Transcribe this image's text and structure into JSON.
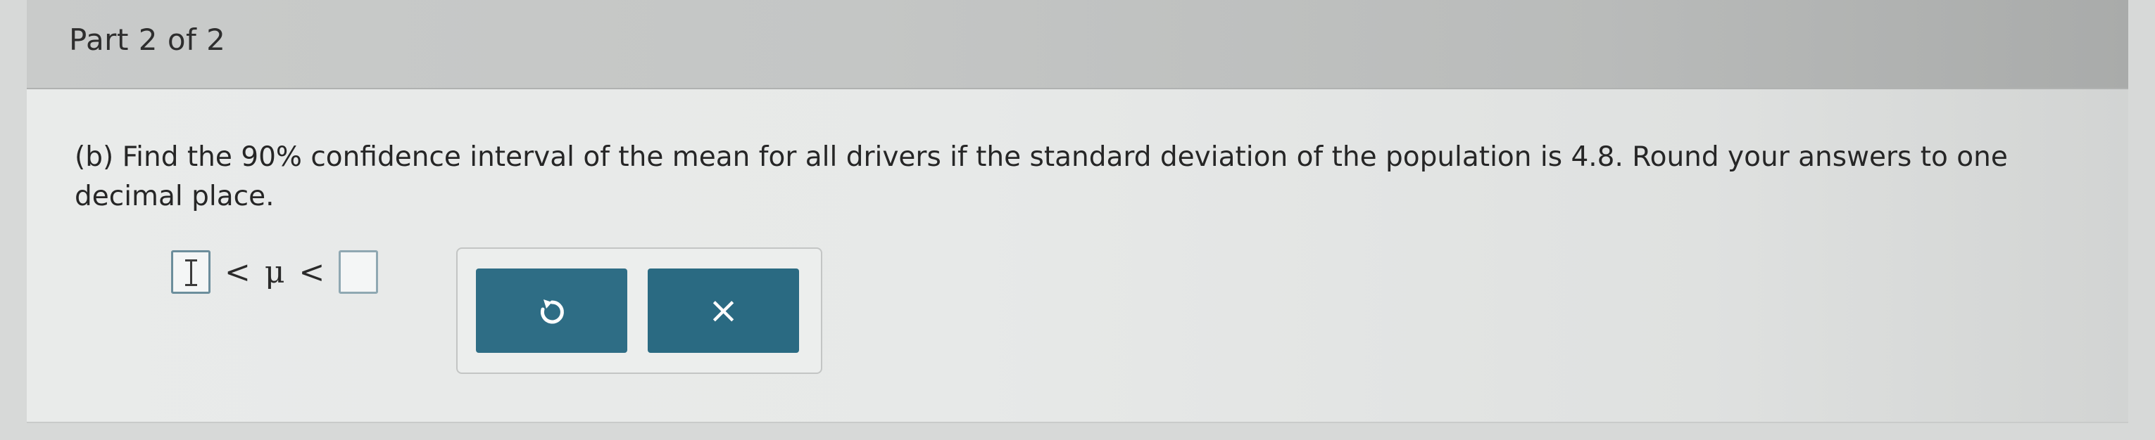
{
  "header": {
    "title": "Part 2 of 2"
  },
  "question": {
    "text": "(b) Find the 90% confidence interval of the mean for all drivers if the standard deviation of the population is 4.8. Round your answers to one decimal place."
  },
  "answer": {
    "lower_value": "",
    "upper_value": "",
    "less_than_left": "<",
    "mu_symbol": "μ",
    "less_than_right": "<"
  },
  "buttons": {
    "undo_icon": "undo-icon",
    "clear_label": "×",
    "clear_icon": "close-icon"
  },
  "colors": {
    "button_bg": "#2f6f87",
    "input_border": "#8fa8b2"
  }
}
